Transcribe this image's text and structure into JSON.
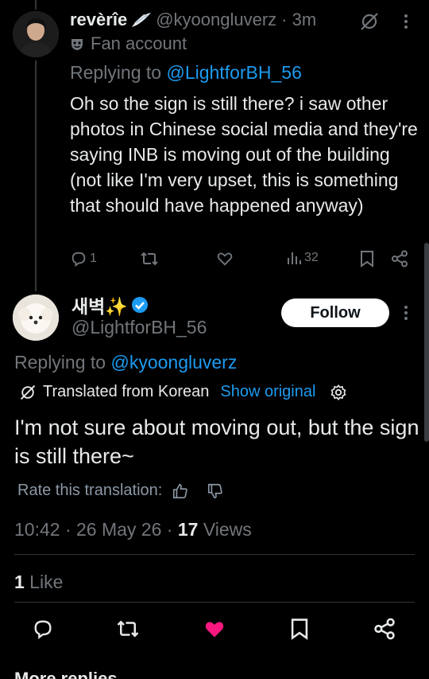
{
  "reply": {
    "display_name": "revèrîe",
    "handle": "@kyoongluverz",
    "time": "· 3m",
    "label": "Fan account",
    "replying_prefix": "Replying to",
    "replying_handle": "@LightforBH_56",
    "text": "Oh so the sign is still there? i saw other photos in Chinese social media and they're saying INB is moving out of the building (not like I'm very upset, this is something that should have happened anyway)",
    "reply_count": "1",
    "views_count": "32"
  },
  "tweet": {
    "display_name": "새벽✨",
    "handle": "@LightforBH_56",
    "follow_label": "Follow",
    "replying_prefix": "Replying to",
    "replying_handle": "@kyoongluverz",
    "translated_label": "Translated from Korean",
    "show_original": "Show original",
    "text": "I'm not sure about moving out, but the sign is still there~",
    "rate_label": "Rate this translation:",
    "time": "10:42 · 26 May 26 · ",
    "views_count": "17",
    "views_label": " Views",
    "likes_count": "1",
    "likes_label": " Like"
  },
  "more_replies": "More replies",
  "colors": {
    "accent": "#1d9bf0",
    "like": "#f91880",
    "muted": "#71767b"
  }
}
